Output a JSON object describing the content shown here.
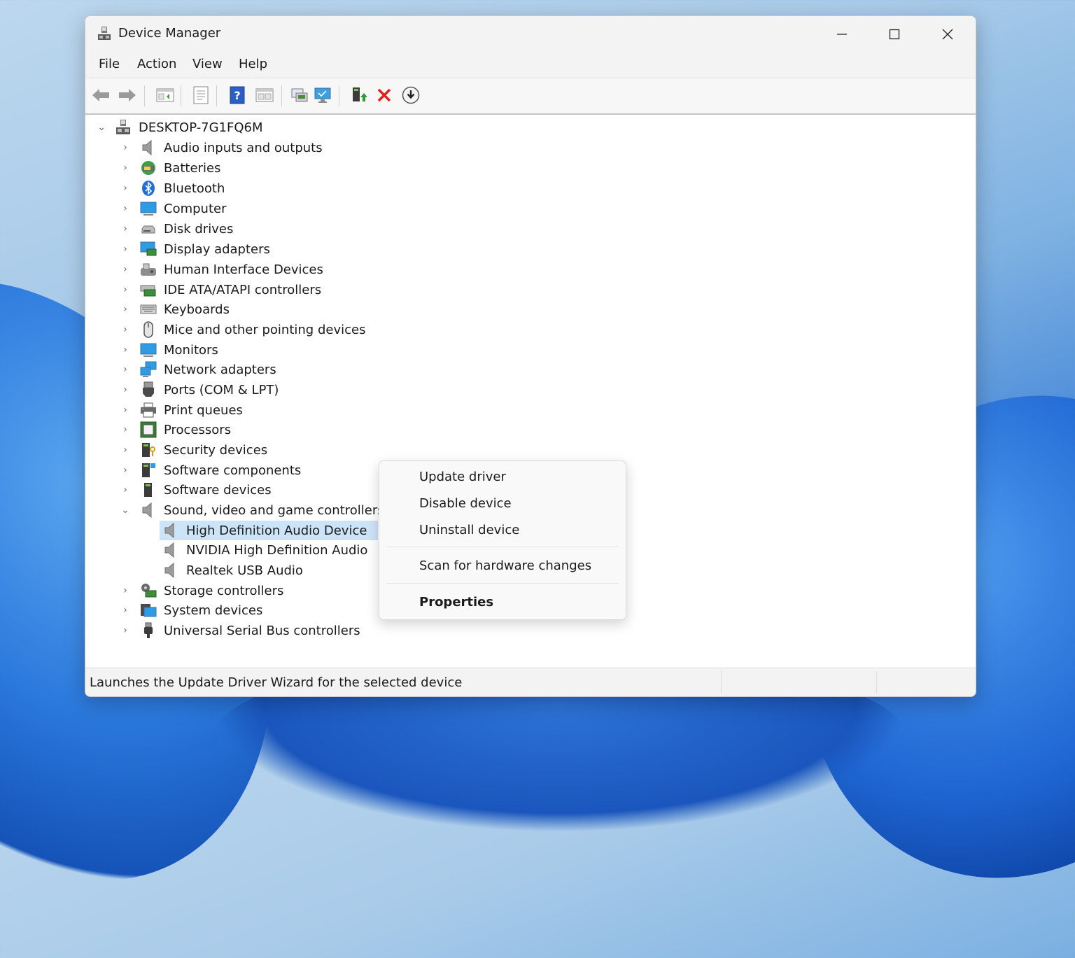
{
  "window": {
    "title": "Device Manager",
    "controls": {
      "minimize": "—",
      "maximize": "☐",
      "close": "✕"
    }
  },
  "menu": [
    "File",
    "Action",
    "View",
    "Help"
  ],
  "toolbar_icons": [
    "back-arrow-icon",
    "forward-arrow-icon",
    "show-hide-tree-icon",
    "properties-icon",
    "help-icon",
    "view-icon",
    "scan-hardware-icon",
    "monitor-icon",
    "update-driver-icon",
    "uninstall-icon",
    "download-icon"
  ],
  "tree": {
    "root": "DESKTOP-7G1FQ6M",
    "categories": [
      "Audio inputs and outputs",
      "Batteries",
      "Bluetooth",
      "Computer",
      "Disk drives",
      "Display adapters",
      "Human Interface Devices",
      "IDE ATA/ATAPI controllers",
      "Keyboards",
      "Mice and other pointing devices",
      "Monitors",
      "Network adapters",
      "Ports (COM & LPT)",
      "Print queues",
      "Processors",
      "Security devices",
      "Software components",
      "Software devices",
      "Sound, video and game controllers",
      "Storage controllers",
      "System devices",
      "Universal Serial Bus controllers"
    ],
    "expanded_children": [
      "High Definition Audio Device",
      "NVIDIA High Definition Audio",
      "Realtek USB Audio"
    ]
  },
  "context_menu": {
    "items": [
      "Update driver",
      "Disable device",
      "Uninstall device",
      "Scan for hardware changes",
      "Properties"
    ]
  },
  "status": {
    "text": "Launches the Update Driver Wizard for the selected device"
  },
  "colors": {
    "selection": "#cce4f7",
    "accent": "#0067c0",
    "uninstall_red": "#e0201b"
  }
}
